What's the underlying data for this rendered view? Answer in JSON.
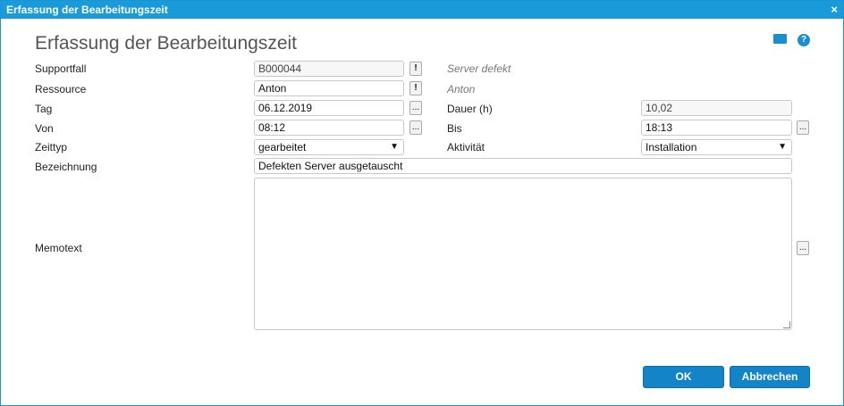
{
  "window": {
    "title": "Erfassung der Bearbeitungszeit",
    "close_label": "×"
  },
  "form": {
    "heading": "Erfassung der Bearbeitungszeit",
    "supportfall": {
      "label": "Supportfall",
      "value": "B000044",
      "hint": "Server defekt",
      "button": "!"
    },
    "ressource": {
      "label": "Ressource",
      "value": "Anton",
      "hint": "Anton",
      "button": "!"
    },
    "tag": {
      "label": "Tag",
      "value": "06.12.2019",
      "button": "..."
    },
    "dauer": {
      "label": "Dauer (h)",
      "value": "10,02"
    },
    "von": {
      "label": "Von",
      "value": "08:12",
      "button": "..."
    },
    "bis": {
      "label": "Bis",
      "value": "18:13",
      "button": "..."
    },
    "zeittyp": {
      "label": "Zeittyp",
      "value": "gearbeitet",
      "arrow": "▼"
    },
    "aktivitaet": {
      "label": "Aktivität",
      "value": "Installation",
      "arrow": "▼"
    },
    "bezeichnung": {
      "label": "Bezeichnung",
      "value": "Defekten Server ausgetauscht"
    },
    "memotext": {
      "label": "Memotext",
      "value": "",
      "button": "..."
    }
  },
  "buttons": {
    "ok": "OK",
    "cancel": "Abbrechen"
  },
  "icons": {
    "mail": "mail-icon",
    "help": "help-icon"
  },
  "colors": {
    "titlebar": "#1a9ad9",
    "button": "#1484c8"
  }
}
